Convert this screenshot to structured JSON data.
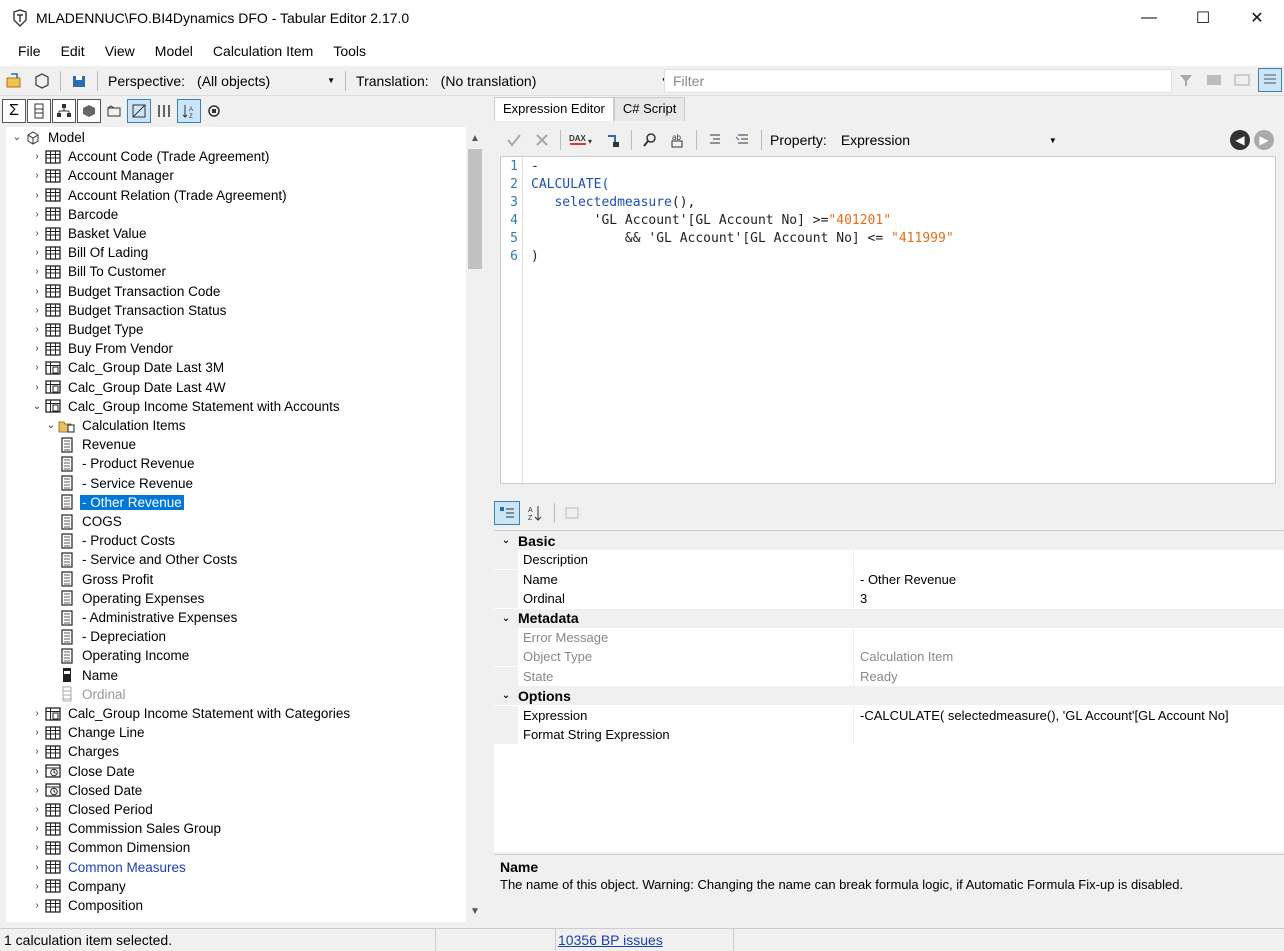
{
  "window": {
    "title": "MLADENNUC\\FO.BI4Dynamics DFO - Tabular Editor 2.17.0",
    "minimize": "—",
    "maximize": "☐",
    "close": "✕"
  },
  "menu": [
    "File",
    "Edit",
    "View",
    "Model",
    "Calculation Item",
    "Tools"
  ],
  "toolbar": {
    "perspective_label": "Perspective:",
    "perspective_value": "(All objects)",
    "translation_label": "Translation:",
    "translation_value": "(No translation)",
    "filter_placeholder": "Filter"
  },
  "tree": {
    "root": "Model",
    "items": [
      {
        "label": "Account Code (Trade Agreement)",
        "icon": "table-icon",
        "level": 1,
        "chevron": "›"
      },
      {
        "label": "Account Manager",
        "icon": "table-icon",
        "level": 1,
        "chevron": "›"
      },
      {
        "label": "Account Relation (Trade Agreement)",
        "icon": "table-icon",
        "level": 1,
        "chevron": "›"
      },
      {
        "label": "Barcode",
        "icon": "table-icon",
        "level": 1,
        "chevron": "›"
      },
      {
        "label": "Basket Value",
        "icon": "table-icon",
        "level": 1,
        "chevron": "›"
      },
      {
        "label": "Bill Of Lading",
        "icon": "table-icon",
        "level": 1,
        "chevron": "›"
      },
      {
        "label": "Bill To Customer",
        "icon": "table-icon",
        "level": 1,
        "chevron": "›"
      },
      {
        "label": "Budget Transaction Code",
        "icon": "table-icon",
        "level": 1,
        "chevron": "›"
      },
      {
        "label": "Budget Transaction Status",
        "icon": "table-icon",
        "level": 1,
        "chevron": "›"
      },
      {
        "label": "Budget Type",
        "icon": "table-icon",
        "level": 1,
        "chevron": "›"
      },
      {
        "label": "Buy From Vendor",
        "icon": "table-icon",
        "level": 1,
        "chevron": "›"
      },
      {
        "label": "Calc_Group Date Last 3M",
        "icon": "calc-group-icon",
        "level": 1,
        "chevron": "›"
      },
      {
        "label": "Calc_Group Date Last 4W",
        "icon": "calc-group-icon",
        "level": 1,
        "chevron": "›"
      },
      {
        "label": "Calc_Group Income Statement with Accounts",
        "icon": "calc-group-icon",
        "level": 1,
        "chevron": "⌄"
      },
      {
        "label": "Calculation Items",
        "icon": "folder-icon",
        "level": 2,
        "chevron": "⌄"
      },
      {
        "label": "Revenue",
        "icon": "calc-item-icon",
        "level": 3,
        "chevron": ""
      },
      {
        "label": " - Product Revenue",
        "icon": "calc-item-icon",
        "level": 3,
        "chevron": ""
      },
      {
        "label": " - Service Revenue",
        "icon": "calc-item-icon",
        "level": 3,
        "chevron": ""
      },
      {
        "label": " - Other Revenue",
        "icon": "calc-item-icon",
        "level": 3,
        "chevron": "",
        "selected": true
      },
      {
        "label": "COGS",
        "icon": "calc-item-icon",
        "level": 3,
        "chevron": ""
      },
      {
        "label": " - Product Costs",
        "icon": "calc-item-icon",
        "level": 3,
        "chevron": ""
      },
      {
        "label": " - Service and Other Costs",
        "icon": "calc-item-icon",
        "level": 3,
        "chevron": ""
      },
      {
        "label": "Gross Profit",
        "icon": "calc-item-icon",
        "level": 3,
        "chevron": ""
      },
      {
        "label": "Operating Expenses",
        "icon": "calc-item-icon",
        "level": 3,
        "chevron": ""
      },
      {
        "label": " - Administrative Expenses",
        "icon": "calc-item-icon",
        "level": 3,
        "chevron": ""
      },
      {
        "label": " - Depreciation",
        "icon": "calc-item-icon",
        "level": 3,
        "chevron": ""
      },
      {
        "label": "Operating Income",
        "icon": "calc-item-icon",
        "level": 3,
        "chevron": ""
      },
      {
        "label": "Name",
        "icon": "column-icon",
        "level": 2,
        "chevron": ""
      },
      {
        "label": "Ordinal",
        "icon": "column-hidden-icon",
        "level": 2,
        "chevron": "",
        "gray": true
      },
      {
        "label": "Calc_Group Income Statement with Categories",
        "icon": "calc-group-icon",
        "level": 1,
        "chevron": "›"
      },
      {
        "label": "Change Line",
        "icon": "table-icon",
        "level": 1,
        "chevron": "›"
      },
      {
        "label": "Charges",
        "icon": "table-icon",
        "level": 1,
        "chevron": "›"
      },
      {
        "label": "Close Date",
        "icon": "date-table-icon",
        "level": 1,
        "chevron": "›"
      },
      {
        "label": "Closed Date",
        "icon": "date-table-icon",
        "level": 1,
        "chevron": "›"
      },
      {
        "label": "Closed Period",
        "icon": "table-icon",
        "level": 1,
        "chevron": "›"
      },
      {
        "label": "Commission Sales Group",
        "icon": "table-icon",
        "level": 1,
        "chevron": "›"
      },
      {
        "label": "Common Dimension",
        "icon": "table-icon",
        "level": 1,
        "chevron": "›"
      },
      {
        "label": "Common Measures",
        "icon": "table-icon",
        "level": 1,
        "chevron": "›",
        "blue": true
      },
      {
        "label": "Company",
        "icon": "table-icon",
        "level": 1,
        "chevron": "›"
      },
      {
        "label": "Composition",
        "icon": "table-icon",
        "level": 1,
        "chevron": "›"
      }
    ]
  },
  "editor": {
    "tabs": [
      "Expression Editor",
      "C# Script"
    ],
    "property_label": "Property:",
    "property_value": "Expression",
    "lines": [
      [
        {
          "t": "-",
          "c": "plain"
        }
      ],
      [
        {
          "t": "CALCULATE(",
          "c": "kw"
        }
      ],
      [
        {
          "t": "   selectedmeasure",
          "c": "fn"
        },
        {
          "t": "(),",
          "c": "plain"
        }
      ],
      [
        {
          "t": "        'GL Account'[GL Account No] >=",
          "c": "plain"
        },
        {
          "t": "\"401201\"",
          "c": "str"
        }
      ],
      [
        {
          "t": "            && 'GL Account'[GL Account No] <= ",
          "c": "plain"
        },
        {
          "t": "\"411999\"",
          "c": "str"
        }
      ],
      [
        {
          "t": ")",
          "c": "plain"
        }
      ]
    ]
  },
  "properties": {
    "rows": [
      {
        "type": "cat",
        "key": "Basic"
      },
      {
        "type": "prop",
        "key": "Description",
        "val": ""
      },
      {
        "type": "prop",
        "key": "Name",
        "val": " - Other Revenue"
      },
      {
        "type": "prop",
        "key": "Ordinal",
        "val": "3"
      },
      {
        "type": "cat",
        "key": "Metadata"
      },
      {
        "type": "prop",
        "key": "Error Message",
        "val": "",
        "ro": true
      },
      {
        "type": "prop",
        "key": "Object Type",
        "val": "Calculation Item",
        "ro": true
      },
      {
        "type": "prop",
        "key": "State",
        "val": "Ready",
        "ro": true
      },
      {
        "type": "cat",
        "key": "Options"
      },
      {
        "type": "prop",
        "key": "Expression",
        "val": "-CALCULATE(   selectedmeasure(),          'GL Account'[GL Account No]"
      },
      {
        "type": "prop",
        "key": "Format String Expression",
        "val": ""
      }
    ],
    "desc_title": "Name",
    "desc_text": "The name of this object. Warning: Changing the name can break formula logic, if Automatic Formula Fix-up is disabled."
  },
  "status": {
    "selection": "1 calculation item selected.",
    "bp_issues": "10356 BP issues"
  }
}
